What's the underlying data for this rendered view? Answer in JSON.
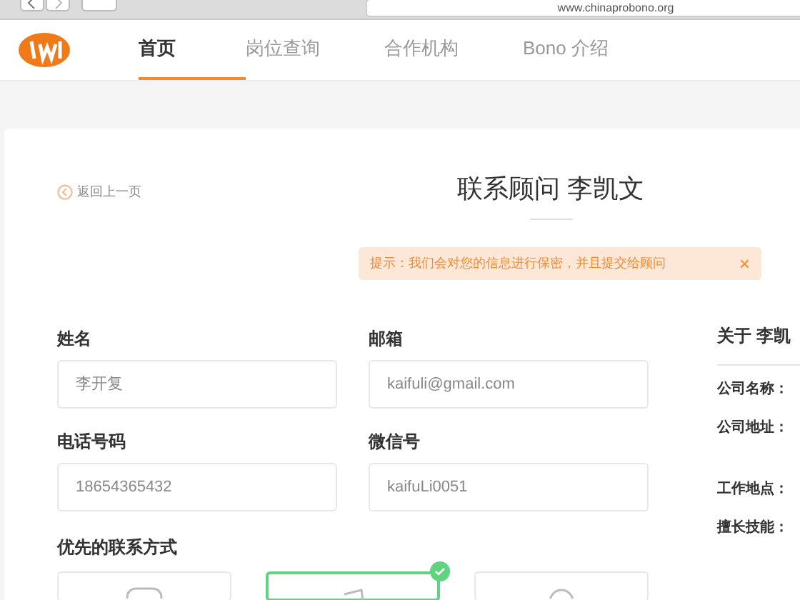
{
  "browser": {
    "url": "www.chinaprobono.org"
  },
  "nav": {
    "items": [
      {
        "label": "首页",
        "selected": true
      },
      {
        "label": "岗位查询",
        "selected": false
      },
      {
        "label": "合作机构",
        "selected": false
      },
      {
        "label": "Bono 介绍",
        "selected": false
      }
    ]
  },
  "back_link": "返回上一页",
  "title": "联系顾问 李凯文",
  "alert": {
    "text": "提示：我们会对您的信息进行保密，并且提交给顾问",
    "close": "×"
  },
  "form": {
    "fields": [
      {
        "label": "姓名",
        "value": "李开复"
      },
      {
        "label": "邮箱",
        "value": "kaifuli@gmail.com"
      },
      {
        "label": "电话号码",
        "value": "18654365432"
      },
      {
        "label": "微信号",
        "value": "kaifuLi0051"
      }
    ],
    "contact_label": "优先的联系方式",
    "contact_options": [
      {
        "kind": "phone",
        "selected": false
      },
      {
        "kind": "wechat",
        "selected": true
      },
      {
        "kind": "email",
        "selected": false
      }
    ]
  },
  "about": {
    "title": "关于 李凯",
    "rows": [
      "公司名称：",
      "公司地址：",
      "工作地点：",
      "擅长技能："
    ]
  }
}
